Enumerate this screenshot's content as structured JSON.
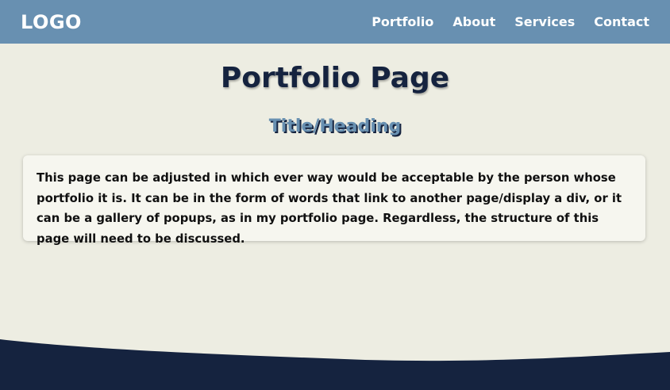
{
  "navbar": {
    "logo": "LOGO",
    "links": [
      {
        "label": "Portfolio"
      },
      {
        "label": "About"
      },
      {
        "label": "Services"
      },
      {
        "label": "Contact"
      }
    ]
  },
  "main": {
    "title": "Portfolio Page",
    "heading": "Title/Heading",
    "body_text": "This page can be adjusted in which ever way would be acceptable by the person whose portfolio it is. It can be in the form of words that link to another page/display a div, or it can be a gallery of popups, as in my portfolio page. Regardless, the structure of this page will need to be discussed."
  },
  "colors": {
    "navbar": "#6890b1",
    "page_background": "#edede2",
    "dark_navy": "#15233f",
    "card_background": "#f6f6ef"
  }
}
